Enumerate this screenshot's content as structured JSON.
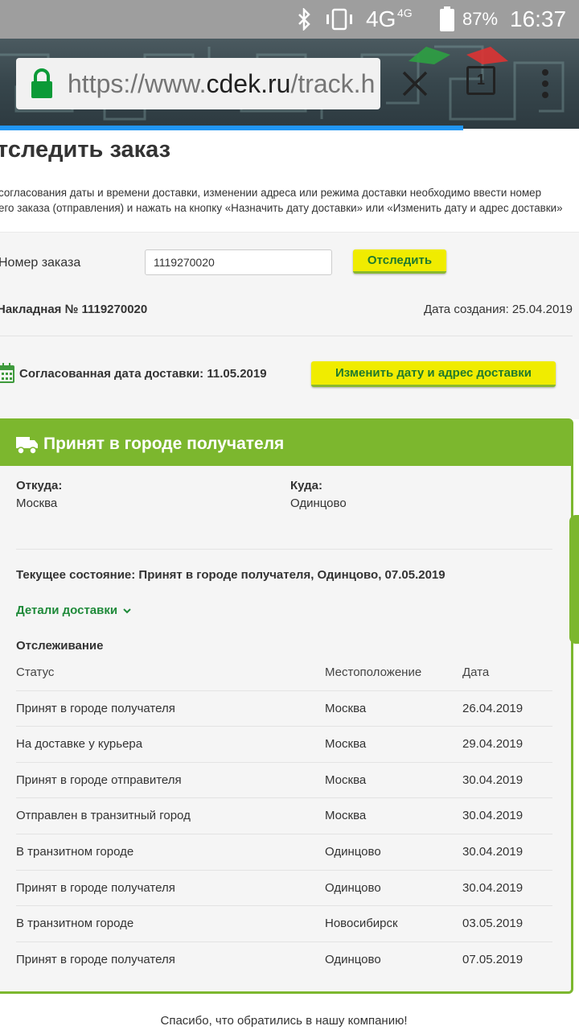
{
  "status_bar": {
    "network": "4G",
    "network_sup": "4G",
    "battery": "87%",
    "time": "16:37"
  },
  "browser": {
    "url_prefix": "https://www.",
    "url_domain": "cdek.ru",
    "url_path": "/track.h",
    "tab_count": "1"
  },
  "page": {
    "title": "тследить заказ",
    "intro_line1": "согласования даты и времени доставки, изменении адреса или режима доставки необходимо ввести номер",
    "intro_line2": "его заказа (отправления) и нажать на кнопку «Назначить дату доставки» или «Изменить дату и адрес доставки»"
  },
  "form": {
    "order_label": "Номер заказа",
    "order_value": "1119270020",
    "track_button": "Отследить"
  },
  "waybill": {
    "number_text": "Накладная № 1119270020",
    "created_text": "Дата создания: 25.04.2019",
    "agreed_text": "Согласованная дата доставки: 11.05.2019",
    "change_button": "Изменить дату и адрес доставки"
  },
  "status_card": {
    "title": "Принят в городе получателя",
    "from_label": "Откуда:",
    "from_value": "Москва",
    "to_label": "Куда:",
    "to_value": "Одинцово",
    "current_state": "Текущее состояние: Принят в городе получателя, Одинцово, 07.05.2019",
    "details_link": "Детали доставки",
    "tracking_title": "Отслеживание"
  },
  "tracking": {
    "headers": {
      "status": "Статус",
      "location": "Местоположение",
      "date": "Дата"
    },
    "rows": [
      {
        "status": "Принят в городе получателя",
        "location": "Москва",
        "date": "26.04.2019"
      },
      {
        "status": "На доставке у курьера",
        "location": "Москва",
        "date": "29.04.2019"
      },
      {
        "status": "Принят в городе отправителя",
        "location": "Москва",
        "date": "30.04.2019"
      },
      {
        "status": "Отправлен в транзитный город",
        "location": "Москва",
        "date": "30.04.2019"
      },
      {
        "status": "В транзитном городе",
        "location": "Одинцово",
        "date": "30.04.2019"
      },
      {
        "status": "Принят в городе получателя",
        "location": "Одинцово",
        "date": "30.04.2019"
      },
      {
        "status": "В транзитном городе",
        "location": "Новосибирск",
        "date": "03.05.2019"
      },
      {
        "status": "Принят в городе получателя",
        "location": "Одинцово",
        "date": "07.05.2019"
      }
    ]
  },
  "footer": {
    "thanks": "Спасибо, что обратились в нашу компанию!"
  },
  "colors": {
    "brand_green": "#7cb72e",
    "button_yellow": "#f0ec00",
    "link_green": "#1f8a3a",
    "progress_blue": "#2196f3"
  },
  "icons": [
    "bluetooth-icon",
    "vibrate-icon",
    "battery-icon",
    "lock-icon",
    "close-icon",
    "tabs-icon",
    "more-icon",
    "calendar-icon",
    "truck-icon",
    "chevron-down-icon"
  ]
}
